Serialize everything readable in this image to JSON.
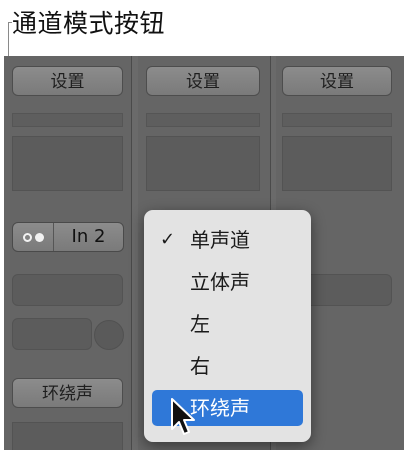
{
  "callout": {
    "text": "通道模式按钮"
  },
  "channels": {
    "settings_label": "设置",
    "input_label": "In 2",
    "output_label": "环绕声"
  },
  "icons": {
    "mode_indicator": "mono-stereo-dots-icon",
    "checkmark": "checkmark-icon",
    "cursor": "arrow-cursor-icon"
  },
  "menu": {
    "items": [
      {
        "label": "单声道",
        "checked": true
      },
      {
        "label": "立体声",
        "checked": false
      },
      {
        "label": "左",
        "checked": false
      },
      {
        "label": "右",
        "checked": false
      },
      {
        "label": "环绕声",
        "checked": false,
        "highlighted": true
      }
    ],
    "check_mark": "✓"
  },
  "colors": {
    "highlight": "#2f78d8",
    "menu_bg": "#e3e3e3",
    "mixer_bg": "#6a6a6a"
  }
}
